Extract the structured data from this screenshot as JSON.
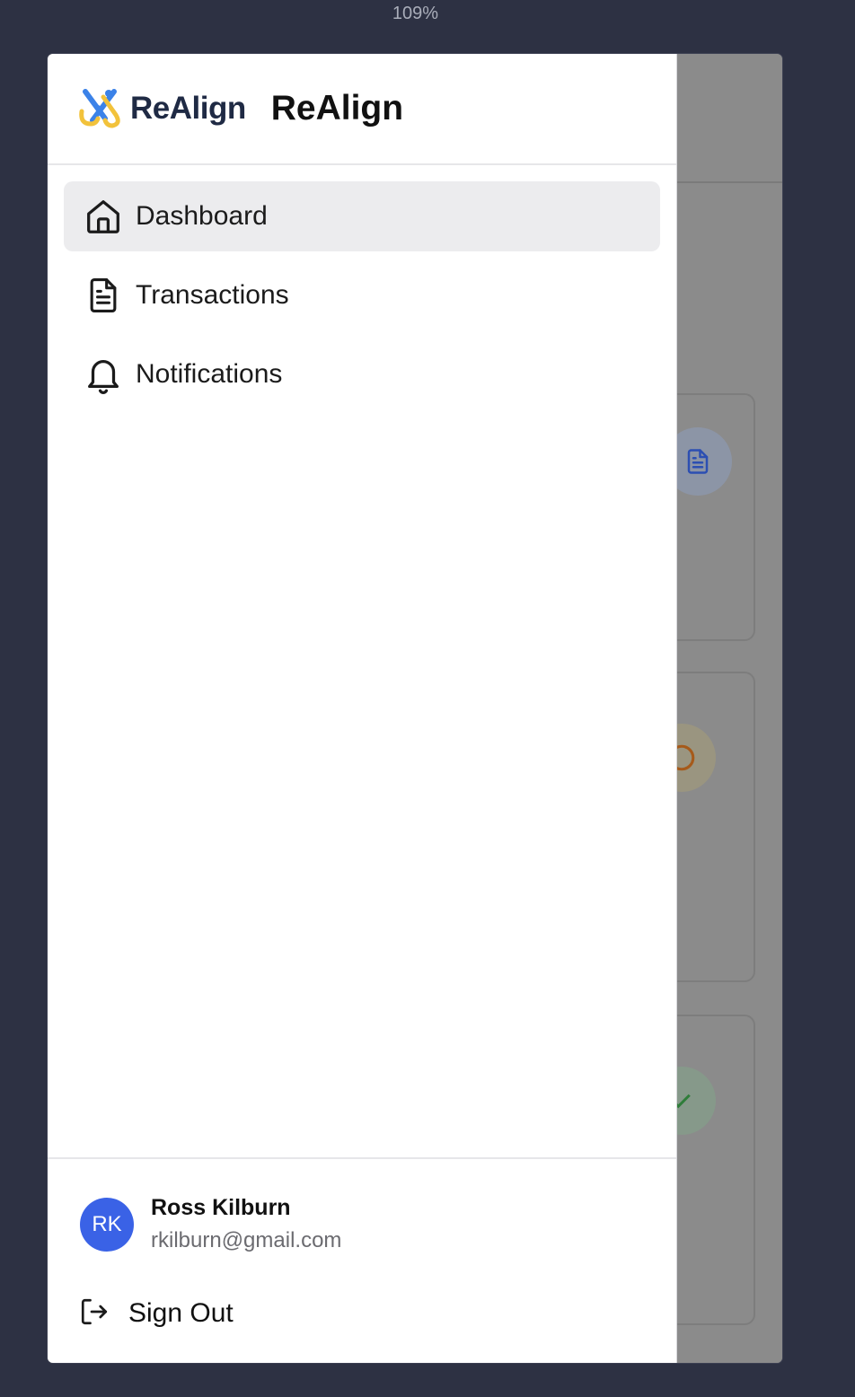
{
  "zoom": {
    "label": "109%"
  },
  "header": {
    "logo_text": "ReAlign",
    "title": "ReAlign"
  },
  "nav": {
    "items": [
      {
        "label": "Dashboard",
        "icon": "home-icon",
        "active": true
      },
      {
        "label": "Transactions",
        "icon": "document-icon",
        "active": false
      },
      {
        "label": "Notifications",
        "icon": "bell-icon",
        "active": false
      }
    ]
  },
  "user": {
    "initials": "RK",
    "name": "Ross Kilburn",
    "email": "rkilburn@gmail.com"
  },
  "footer": {
    "signout_label": "Sign Out",
    "signout_icon": "sign-out-icon"
  },
  "colors": {
    "accent": "#3a62e6",
    "logo_blue": "#3b82e8",
    "logo_yellow": "#f2c23b",
    "active_bg": "#ececee",
    "overlay": "#8b8b8b"
  }
}
